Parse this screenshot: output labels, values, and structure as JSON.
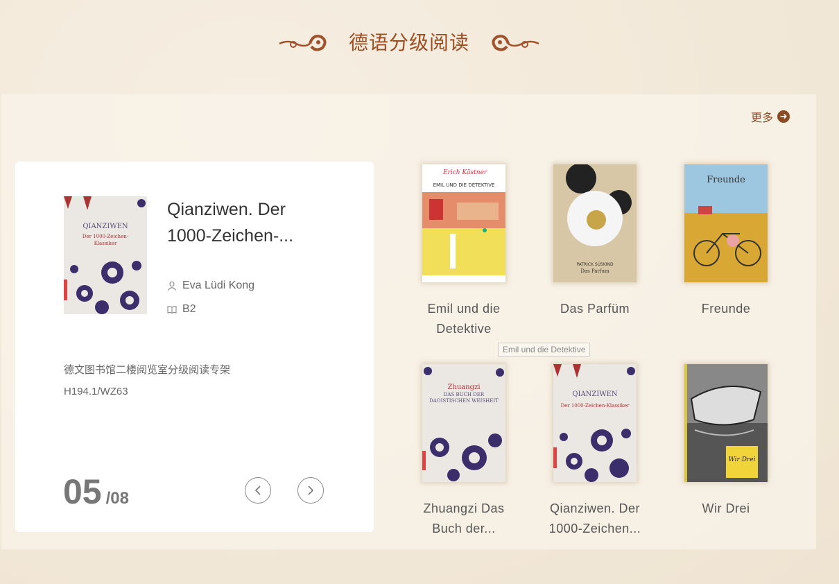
{
  "section": {
    "title": "德语分级阅读",
    "more_label": "更多"
  },
  "featured": {
    "title_line1": "Qianziwen. Der",
    "title_line2": "1000-Zeichen-...",
    "author": "Eva Lüdi Kong",
    "level": "B2",
    "location": "德文图书馆二楼阅览室分级阅读专架",
    "call_number": "H194.1/WZ63",
    "cover_text": {
      "line1": "QIANZIWEN",
      "line2": "Der 1000-Zeichen-",
      "line3": "Klassiker"
    },
    "current": "05",
    "total": "/08"
  },
  "books": [
    {
      "line1": "Emil und die",
      "line2": "Detektive",
      "cover_author": "Erich Kästner",
      "cover_title": "EMIL UND DIE DETEKTIVE"
    },
    {
      "line1": "Das Parfüm",
      "line2": "",
      "cover_author": "PATRICK SÜSKIND",
      "cover_title": "Das Parfum"
    },
    {
      "line1": "Freunde",
      "line2": "",
      "cover_title": "Freunde"
    },
    {
      "line1": "Zhuangzi Das",
      "line2": "Buch der...",
      "cover_author": "Zhuangzi",
      "cover_title": "DAS BUCH DER DAOISTISCHEN WEISHEIT"
    },
    {
      "line1": "Qianziwen. Der",
      "line2": "1000-Zeichen...",
      "cover_author": "QIANZIWEN",
      "cover_title": "Der 1000-Zeichen-Klassiker"
    },
    {
      "line1": "Wir Drei",
      "line2": "",
      "cover_title": "Wir Drei"
    }
  ],
  "tooltip": "Emil und die Detektive",
  "colors": {
    "accent": "#9a4e22",
    "background": "#f3eadb"
  }
}
